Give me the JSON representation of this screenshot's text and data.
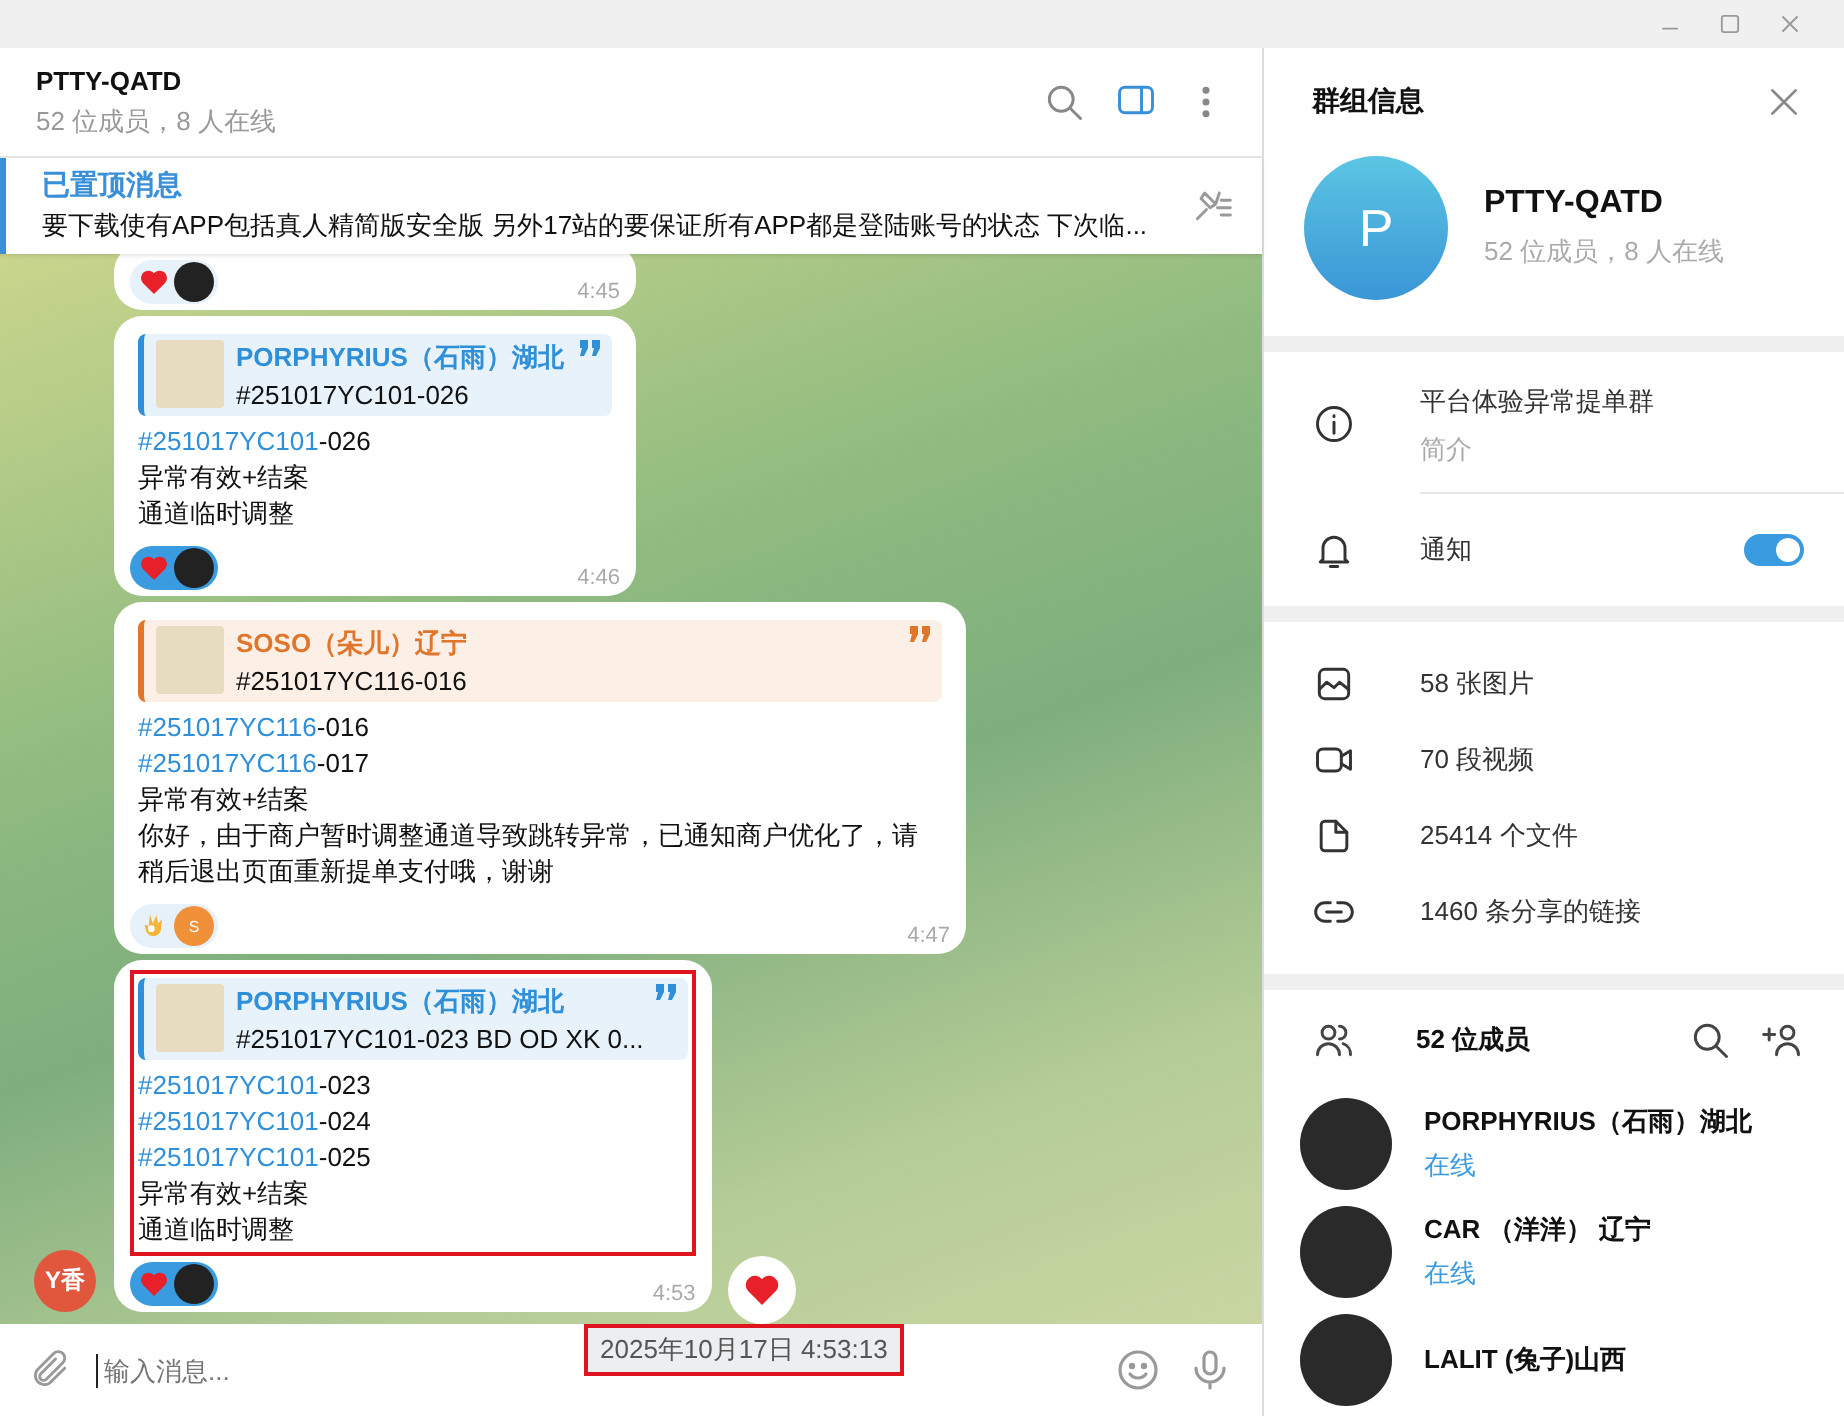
{
  "chat": {
    "title": "PTTY-QATD",
    "subtitle": "52 位成员，8 人在线",
    "pinned": {
      "label": "已置顶消息",
      "text": "要下载使有APP包括真人精简版安全版 另外17站的要保证所有APP都是登陆账号的状态  下次临..."
    },
    "messages": [
      {
        "reactions": [
          {
            "kind": "heart",
            "selected": false
          }
        ],
        "time": "4:45",
        "highlighted": false
      },
      {
        "reply": {
          "author": "PORPHYRIUS（石雨）湖北",
          "text": "#251017YC101-026",
          "color": "#2f8fd8"
        },
        "lines": [
          {
            "kind": "hashtag",
            "tag": "#251017YC101",
            "text": "-026"
          },
          {
            "kind": "text",
            "text": "异常有效+结案"
          },
          {
            "kind": "text",
            "text": "通道临时调整"
          }
        ],
        "reactions": [
          {
            "kind": "heart",
            "selected": true
          }
        ],
        "time": "4:46",
        "highlighted": false
      },
      {
        "reply": {
          "author": "SOSO（朵儿）辽宁",
          "text": "#251017YC116-016",
          "color": "#e0762c"
        },
        "lines": [
          {
            "kind": "hashtag",
            "tag": "#251017YC116",
            "text": "-016"
          },
          {
            "kind": "hashtag",
            "tag": "#251017YC116",
            "text": "-017"
          },
          {
            "kind": "text",
            "text": "异常有效+结案"
          },
          {
            "kind": "text",
            "text": "你好，由于商户暂时调整通道导致跳转异常，已通知商户优化了，请稍后退出页面重新提单支付哦，谢谢"
          }
        ],
        "reactions": [
          {
            "kind": "ok_hand",
            "selected": false,
            "avatar_letter": "S"
          }
        ],
        "time": "4:47",
        "highlighted": false
      },
      {
        "reply": {
          "author": "PORPHYRIUS（石雨）湖北",
          "text": "#251017YC101-023 BD OD XK 0...",
          "color": "#2f8fd8"
        },
        "lines": [
          {
            "kind": "hashtag",
            "tag": "#251017YC101",
            "text": "-023"
          },
          {
            "kind": "hashtag",
            "tag": "#251017YC101",
            "text": "-024"
          },
          {
            "kind": "hashtag",
            "tag": "#251017YC101",
            "text": "-025"
          },
          {
            "kind": "text",
            "text": "异常有效+结案"
          },
          {
            "kind": "text",
            "text": "通道临时调整"
          }
        ],
        "reactions": [
          {
            "kind": "heart",
            "selected": true
          }
        ],
        "time": "4:53",
        "highlighted": true,
        "sender_avatar": "Y香",
        "side_reaction": {
          "kind": "heart"
        }
      }
    ],
    "tooltip": {
      "text": "2025年10月17日 4:53:13",
      "highlighted": true
    },
    "input": {
      "placeholder": "输入消息..."
    }
  },
  "info_panel": {
    "title": "群组信息",
    "group": {
      "avatar_letter": "P",
      "name": "PTTY-QATD",
      "subtitle": "52 位成员，8 人在线"
    },
    "description": {
      "text": "平台体验异常提单群",
      "label": "简介"
    },
    "notifications": {
      "label": "通知",
      "on": true
    },
    "media": [
      {
        "kind": "photos",
        "label": "58 张图片"
      },
      {
        "kind": "videos",
        "label": "70 段视频"
      },
      {
        "kind": "files",
        "label": "25414 个文件"
      },
      {
        "kind": "links",
        "label": "1460 条分享的链接"
      }
    ],
    "members": {
      "title": "52 位成员",
      "list": [
        {
          "name": "PORPHYRIUS（石雨）湖北",
          "status": "在线"
        },
        {
          "name": "CAR （洋洋） 辽宁",
          "status": "在线"
        },
        {
          "name": "LALIT (兔子)山西"
        }
      ]
    }
  }
}
